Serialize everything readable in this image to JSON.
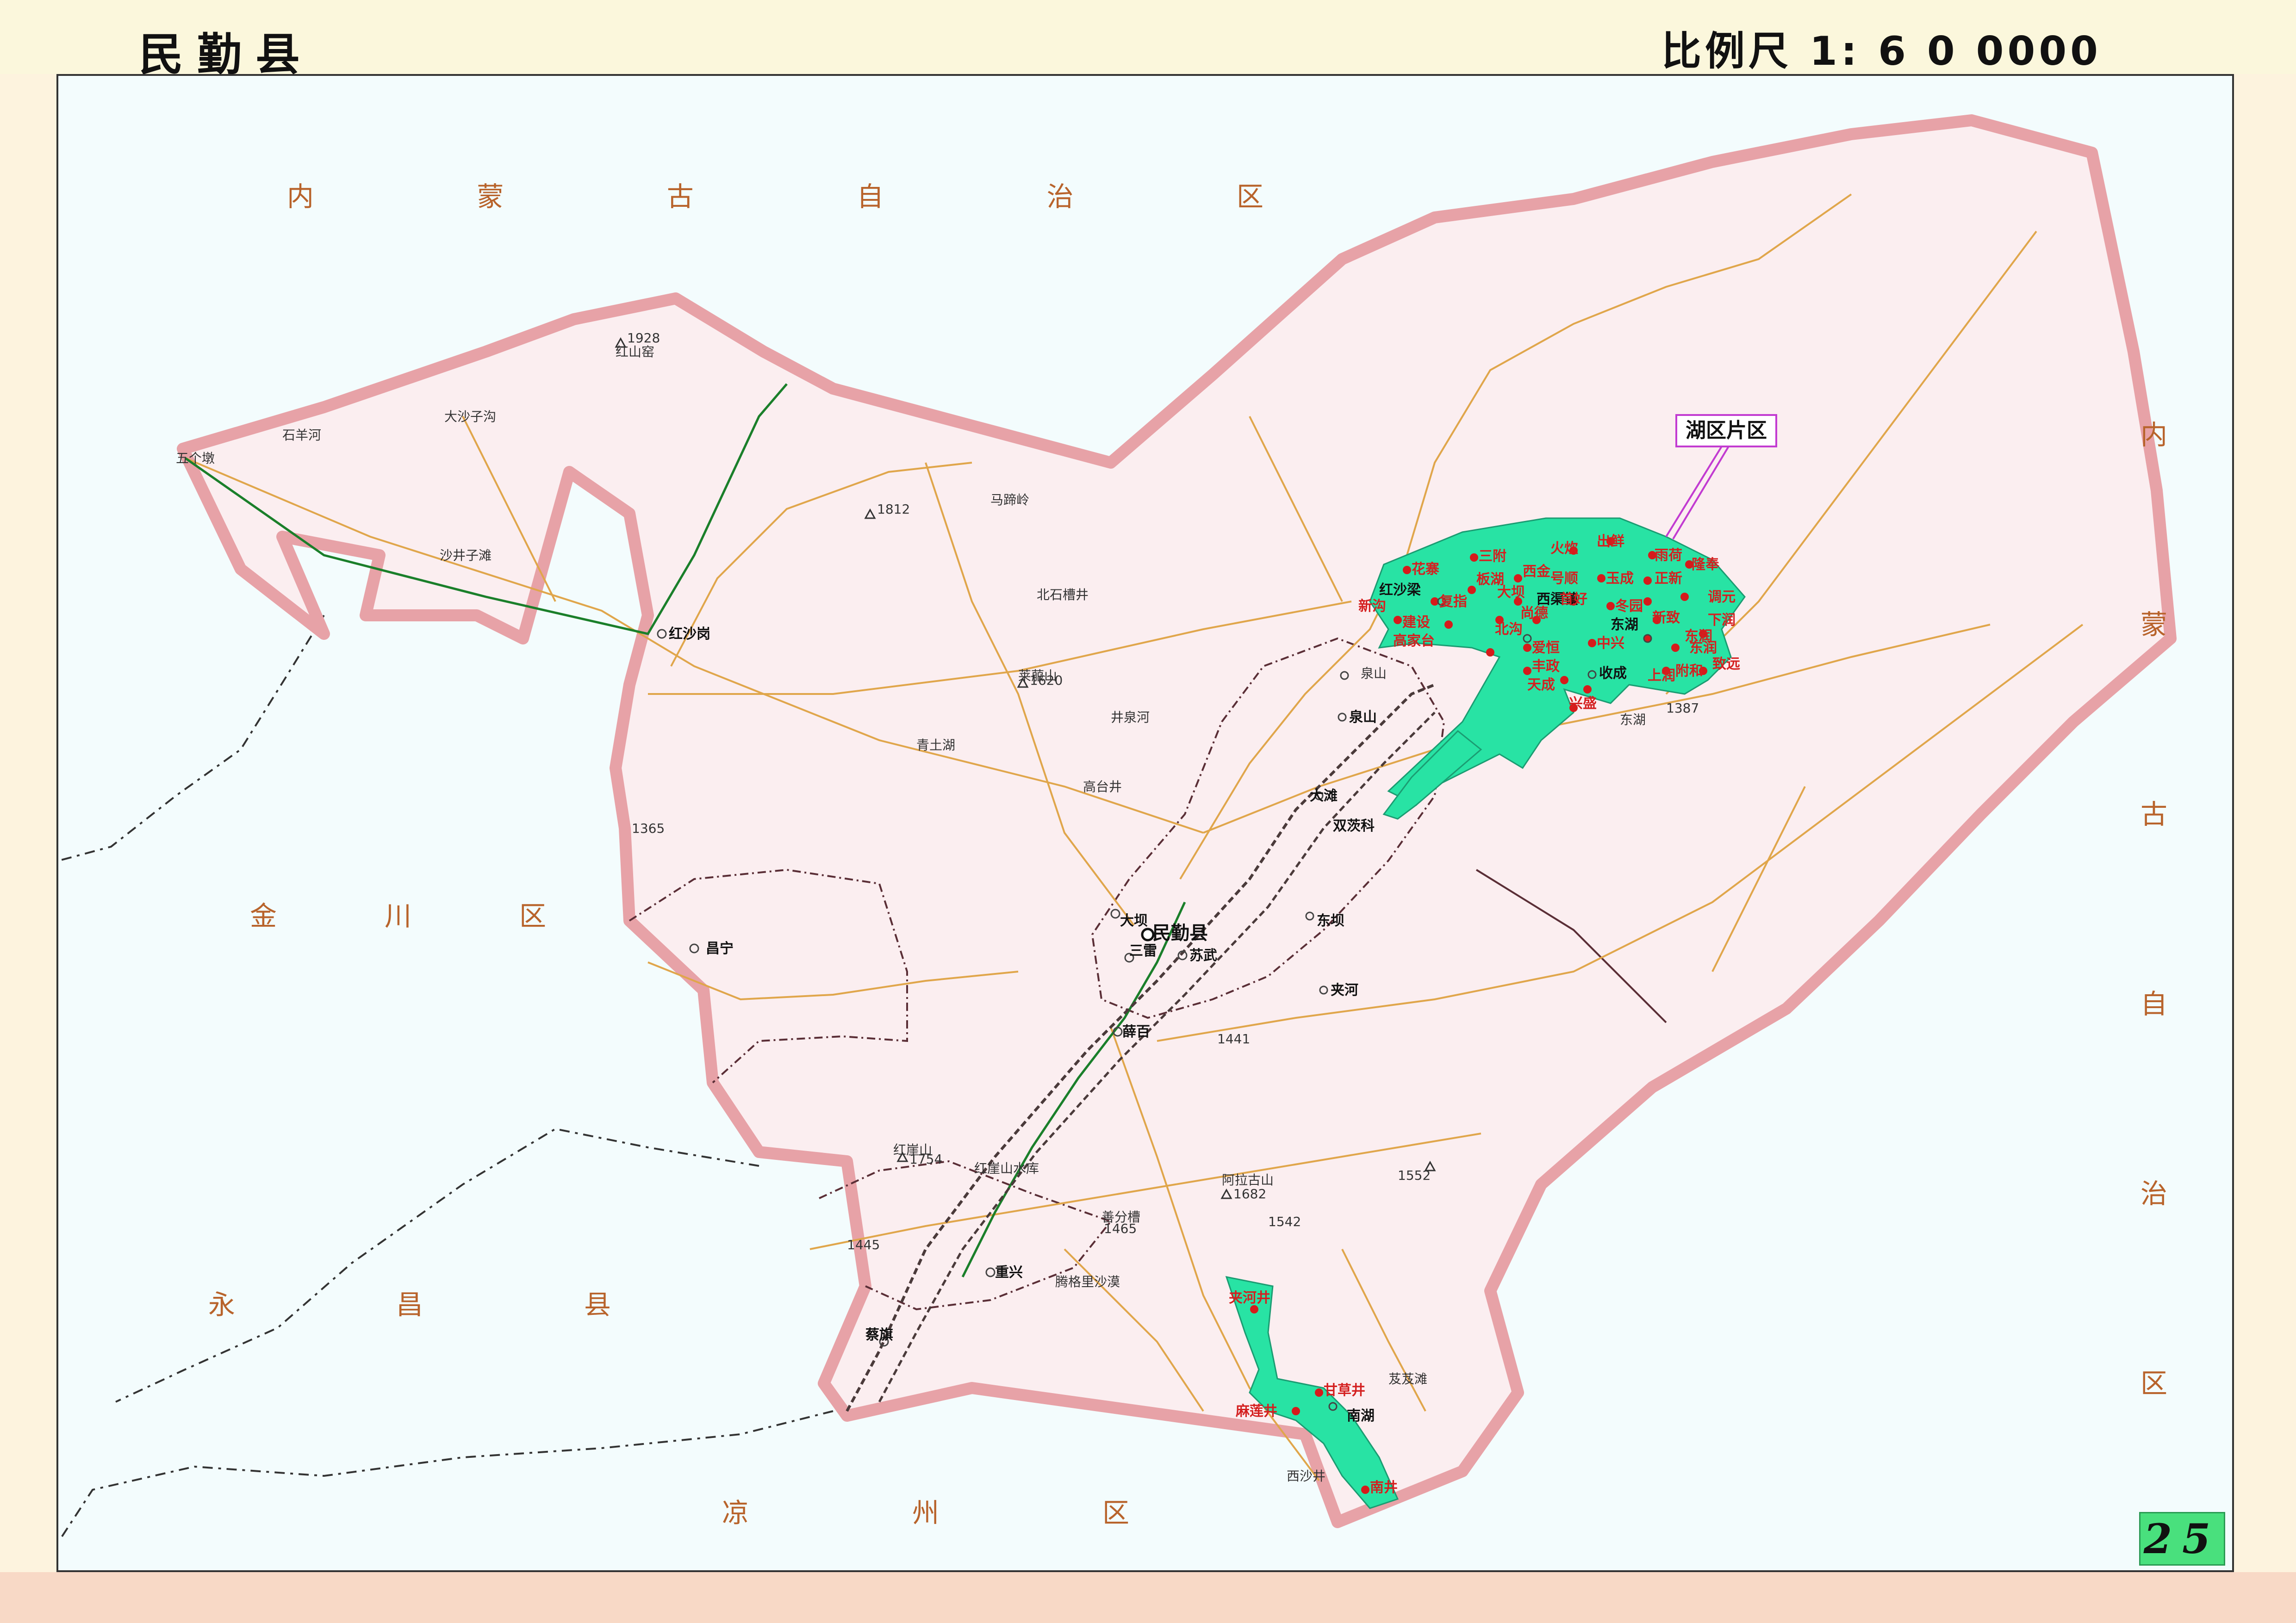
{
  "header": {
    "county_name": "民勤县",
    "scale": "比例尺 1: 6 0 0000"
  },
  "neighbors": {
    "inner_mongolia_top": "内 蒙 古 自 治 区",
    "inner_mongolia_right": [
      "内",
      "蒙",
      "古",
      "自",
      "治",
      "区"
    ],
    "jinchuan": "金 川 区",
    "yongchang": "永 昌 县",
    "liangzhou": "凉 州 区"
  },
  "callout": "湖区片区",
  "page_number": "25",
  "colors": {
    "county_fill": "#fbeef0",
    "county_border": "#e7a2a7",
    "lake_area": "#28e3a4",
    "road": "#e0a64b",
    "railway": "#1a7f2a",
    "boundary": "#4a4a4a",
    "settlement_dot": "#d61b1b"
  },
  "places": {
    "county_seat": "民勤县",
    "towns": [
      "红沙岗",
      "昌宁",
      "大坝",
      "三雷",
      "苏武",
      "薛百",
      "重兴",
      "蔡旗",
      "泉山",
      "大滩",
      "双茨科",
      "东坝",
      "夹河",
      "红沙梁",
      "西渠镇",
      "东湖",
      "收成",
      "南湖"
    ],
    "lake_villages": [
      "花寨",
      "三附",
      "板湖",
      "大坝",
      "西金",
      "号顺",
      "火炊",
      "玉成",
      "出鲜",
      "雨荷",
      "隆奉",
      "新沟",
      "复指",
      "建设",
      "高家台",
      "北沟",
      "尚德",
      "爱恒",
      "丰政",
      "首好",
      "冬园",
      "中兴",
      "天成",
      "兴盛",
      "上润",
      "附和",
      "东润",
      "下润",
      "调元",
      "正新",
      "新致",
      "东润",
      "致远"
    ],
    "nanhu_villages": [
      "夹河井",
      "甘草井",
      "麻莲井",
      "南井"
    ],
    "misc_points": [
      "红山窑",
      "五个墩",
      "石羊河",
      "大沙子沟",
      "沙井子滩",
      "青土湖",
      "北石槽井",
      "井泉河",
      "莱菔山",
      "马蹄岭",
      "高台井",
      "红崖山",
      "红崖山水库",
      "阿拉古山",
      "善分槽",
      "腾格里沙漠",
      "东湖",
      "泉山",
      "西沙井",
      "芨芨滩"
    ],
    "elevations": [
      "1928",
      "1812",
      "1620",
      "1365",
      "1387",
      "1441",
      "1754",
      "1445",
      "1465",
      "1682",
      "1542",
      "1552"
    ]
  }
}
